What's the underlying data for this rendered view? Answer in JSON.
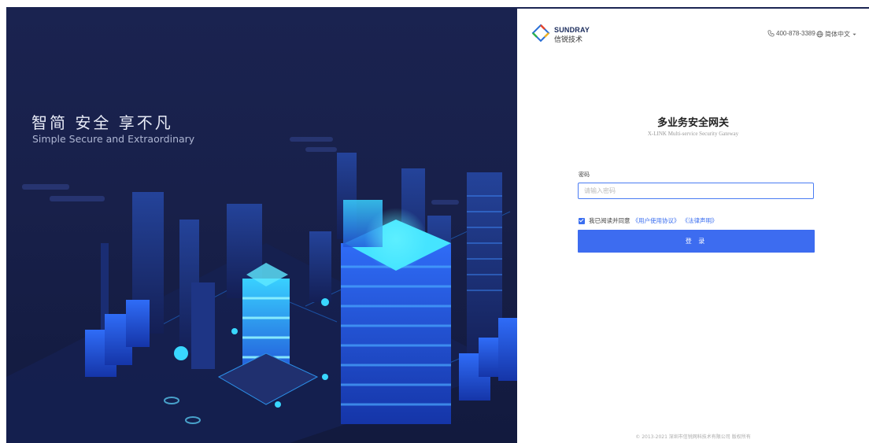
{
  "hero": {
    "slogan_cn": "智简 安全 享不凡",
    "slogan_en": "Simple Secure and Extraordinary"
  },
  "header": {
    "brand_en": "SUNDRAY",
    "brand_cn": "信锐技术",
    "phone": "400-878-3389",
    "language": "简体中文"
  },
  "login": {
    "title": "多业务安全网关",
    "subtitle": "X-LINK Multi-service Security Gateway",
    "password_label": "密码",
    "password_placeholder": "请输入密码",
    "agree_text": "我已阅读并同意",
    "user_agreement": "《用户使用协议》",
    "legal_statement": "《法律声明》",
    "submit": "登 录"
  },
  "footer": {
    "copyright": "© 2013-2021 深圳市信锐网科技术有限公司 版权所有"
  },
  "colors": {
    "accent": "#3d6cf0",
    "hero_bg": "#18204a"
  }
}
